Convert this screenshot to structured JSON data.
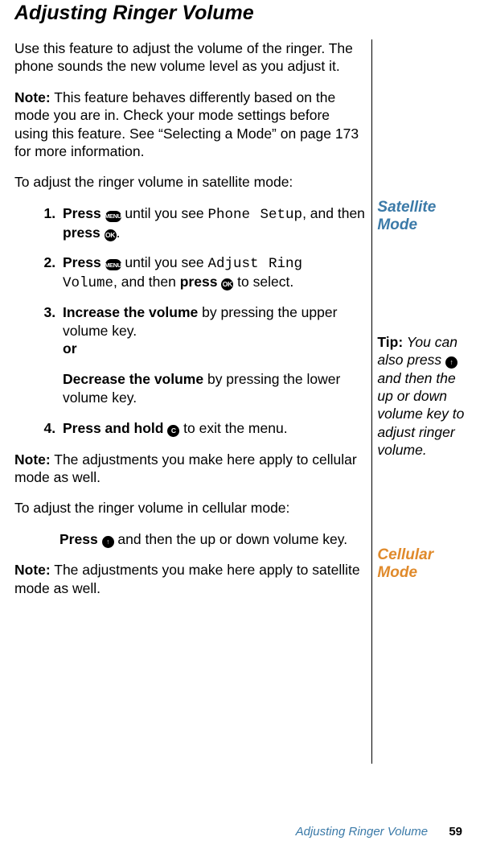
{
  "title": "Adjusting Ringer Volume",
  "intro": "Use this feature to adjust the volume of the ringer. The phone sounds the new volume level as you adjust it.",
  "note1_label": "Note:",
  "note1": " This feature behaves differently based on the mode you are in. Check your mode settings before using this feature. See “Selecting a Mode” on page 173 for more information.",
  "sat_intro": "To adjust the ringer volume in satellite mode:",
  "steps": {
    "s1a": "Press ",
    "s1b": " until you see ",
    "s1_lcd": "Phone Setup",
    "s1c": ", and then ",
    "s1d": "press ",
    "s1e": ".",
    "s2a": "Press ",
    "s2b": " until you see ",
    "s2_lcd": "Adjust Ring Volume",
    "s2c": ", and then ",
    "s2d": "press ",
    "s2e": " to select.",
    "s3a": "Increase the volume",
    "s3b": " by pressing the upper volume key.",
    "s3or": "or",
    "s3c": "Decrease the volume",
    "s3d": " by pressing the lower volume key.",
    "s4a": "Press and hold ",
    "s4b": " to exit the menu."
  },
  "note2_label": "Note:",
  "note2": " The adjustments you make here apply to cellular mode as well.",
  "cell_intro": "To adjust the ringer volume in cellular mode:",
  "cell_step_a": "Press ",
  "cell_step_b": " and then the up or down volume key.",
  "note3_label": "Note:",
  "note3": " The adjustments you make here apply to satellite mode as well.",
  "side": {
    "sat_mode": "Satellite Mode",
    "tip_label": "Tip:",
    "tip_a": " You can also press ",
    "tip_b": " and then the up or down volume key to adjust ringer volume.",
    "cell_mode": "Cellular Mode"
  },
  "icons": {
    "menu": "MENU",
    "ok": "OK",
    "c": "C",
    "up": "↑"
  },
  "footer": {
    "section": "Adjusting Ringer Volume",
    "page": "59"
  }
}
